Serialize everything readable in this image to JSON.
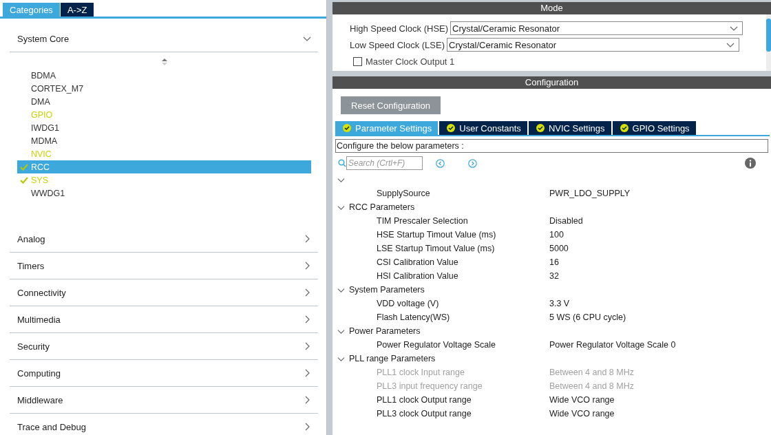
{
  "left_tabs": [
    {
      "label": "Categories",
      "selected": true
    },
    {
      "label": "A->Z",
      "selected": false
    }
  ],
  "categories": [
    {
      "label": "System Core",
      "expanded": true,
      "items": [
        {
          "name": "BDMA",
          "checked": false,
          "enabled": false,
          "selected": false
        },
        {
          "name": "CORTEX_M7",
          "checked": false,
          "enabled": false,
          "selected": false
        },
        {
          "name": "DMA",
          "checked": false,
          "enabled": false,
          "selected": false
        },
        {
          "name": "GPIO",
          "checked": false,
          "enabled": true,
          "selected": false
        },
        {
          "name": "IWDG1",
          "checked": false,
          "enabled": false,
          "selected": false
        },
        {
          "name": "MDMA",
          "checked": false,
          "enabled": false,
          "selected": false
        },
        {
          "name": "NVIC",
          "checked": false,
          "enabled": true,
          "selected": false
        },
        {
          "name": "RCC",
          "checked": true,
          "enabled": true,
          "selected": true
        },
        {
          "name": "SYS",
          "checked": true,
          "enabled": true,
          "selected": false
        },
        {
          "name": "WWDG1",
          "checked": false,
          "enabled": false,
          "selected": false
        }
      ]
    },
    {
      "label": "Analog",
      "expanded": false
    },
    {
      "label": "Timers",
      "expanded": false
    },
    {
      "label": "Connectivity",
      "expanded": false
    },
    {
      "label": "Multimedia",
      "expanded": false
    },
    {
      "label": "Security",
      "expanded": false
    },
    {
      "label": "Computing",
      "expanded": false
    },
    {
      "label": "Middleware",
      "expanded": false
    },
    {
      "label": "Trace and Debug",
      "expanded": false
    }
  ],
  "mode": {
    "title": "Mode",
    "selects": [
      {
        "label": "High Speed Clock (HSE)",
        "value": "Crystal/Ceramic Resonator"
      },
      {
        "label": "Low Speed Clock (LSE)",
        "value": "Crystal/Ceramic Resonator"
      }
    ],
    "checkbox": {
      "label": "Master Clock Output 1",
      "checked": false
    }
  },
  "configuration": {
    "title": "Configuration",
    "reset_button": "Reset Configuration",
    "tabs": [
      {
        "label": "Parameter Settings",
        "selected": true
      },
      {
        "label": "User Constants",
        "selected": false
      },
      {
        "label": "NVIC Settings",
        "selected": false
      },
      {
        "label": "GPIO Settings",
        "selected": false
      }
    ],
    "hint": "Configure the below parameters :",
    "search": {
      "placeholder": "Search (Crtl+F)"
    },
    "groups": [
      {
        "expanded": true,
        "params": [
          {
            "name": "SupplySource",
            "value": "PWR_LDO_SUPPLY",
            "disabled": false
          }
        ]
      },
      {
        "label": "RCC Parameters",
        "expanded": true,
        "params": [
          {
            "name": "TIM Prescaler Selection",
            "value": "Disabled",
            "disabled": false
          },
          {
            "name": "HSE Startup Timout Value (ms)",
            "value": "100",
            "disabled": false
          },
          {
            "name": "LSE Startup Timout Value (ms)",
            "value": "5000",
            "disabled": false
          },
          {
            "name": "CSI Calibration Value",
            "value": "16",
            "disabled": false
          },
          {
            "name": "HSI Calibration Value",
            "value": "32",
            "disabled": false
          }
        ]
      },
      {
        "label": "System Parameters",
        "expanded": true,
        "params": [
          {
            "name": "VDD voltage (V)",
            "value": "3.3 V",
            "disabled": false
          },
          {
            "name": "Flash Latency(WS)",
            "value": "5 WS (6 CPU cycle)",
            "disabled": false
          }
        ]
      },
      {
        "label": "Power Parameters",
        "expanded": true,
        "params": [
          {
            "name": "Power Regulator Voltage Scale",
            "value": "Power Regulator Voltage Scale 0",
            "disabled": false
          }
        ]
      },
      {
        "label": "PLL range Parameters",
        "expanded": true,
        "params": [
          {
            "name": "PLL1 clock Input range",
            "value": "Between 4 and 8 MHz",
            "disabled": true
          },
          {
            "name": "PLL3 input frequency range",
            "value": "Between 4 and 8 MHz",
            "disabled": true
          },
          {
            "name": "PLL1 clock Output range",
            "value": "Wide VCO range",
            "disabled": false
          },
          {
            "name": "PLL3 clock Output range",
            "value": "Wide VCO range",
            "disabled": false
          }
        ]
      }
    ]
  }
}
